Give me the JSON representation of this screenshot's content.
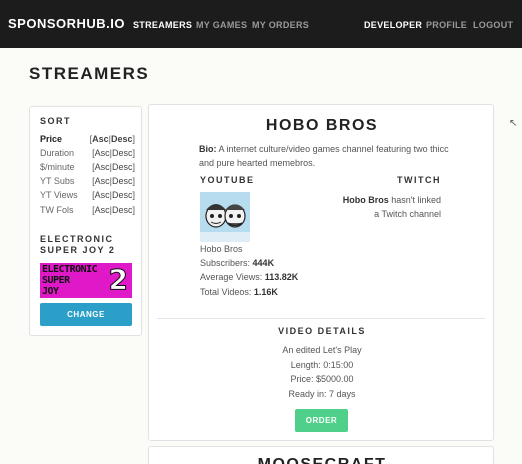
{
  "nav": {
    "brand": "SPONSORHUB.IO",
    "left": [
      {
        "label": "STREAMERS",
        "active": true
      },
      {
        "label": "MY GAMES",
        "active": false
      },
      {
        "label": "MY ORDERS",
        "active": false
      }
    ],
    "right": [
      {
        "label": "DEVELOPER",
        "active": true
      },
      {
        "label": "PROFILE",
        "active": false
      },
      {
        "label": "LOGOUT",
        "active": false
      }
    ]
  },
  "page_title": "STREAMERS",
  "sidebar": {
    "sort_heading": "SORT",
    "sort_rows": [
      {
        "label": "Price",
        "asc": "Asc",
        "desc": "Desc",
        "selected": true
      },
      {
        "label": "Duration",
        "asc": "Asc",
        "desc": "Desc",
        "selected": false
      },
      {
        "label": "$/minute",
        "asc": "Asc",
        "desc": "Desc",
        "selected": false
      },
      {
        "label": "YT Subs",
        "asc": "Asc",
        "desc": "Desc",
        "selected": false
      },
      {
        "label": "YT Views",
        "asc": "Asc",
        "desc": "Desc",
        "selected": false
      },
      {
        "label": "TW Fols",
        "asc": "Asc",
        "desc": "Desc",
        "selected": false
      }
    ],
    "game_heading_line1": "ELECTRONIC",
    "game_heading_line2": "SUPER JOY 2",
    "game_art_text": [
      "ELECTRONIC",
      "SUPER",
      "JOY"
    ],
    "game_art_number": "2",
    "change_label": "CHANGE"
  },
  "streamer": {
    "name": "HOBO BROS",
    "bio_label": "Bio:",
    "bio_text": "A internet culture/video games channel featuring two thicc and pure hearted memebros.",
    "youtube_heading": "YOUTUBE",
    "twitch_heading": "TWITCH",
    "channel_name": "Hobo Bros",
    "subscribers_label": "Subscribers:",
    "subscribers_value": "444K",
    "avg_views_label": "Average Views:",
    "avg_views_value": "113.82K",
    "total_videos_label": "Total Videos:",
    "total_videos_value": "1.16K",
    "twitch_name": "Hobo Bros",
    "twitch_msg_1": "hasn't linked",
    "twitch_msg_2": "a Twitch channel"
  },
  "video_details": {
    "heading": "VIDEO DETAILS",
    "type": "An edited Let's Play",
    "length": "Length: 0:15:00",
    "price": "Price: $5000.00",
    "ready": "Ready in: 7 days",
    "order_label": "ORDER"
  },
  "next_streamer": {
    "name": "MOOSECRAFT"
  },
  "colors": {
    "navbar": "#1c1c1c",
    "change_button": "#2c9fc9",
    "order_button": "#4fd08a",
    "game_art": "#e019c8"
  }
}
